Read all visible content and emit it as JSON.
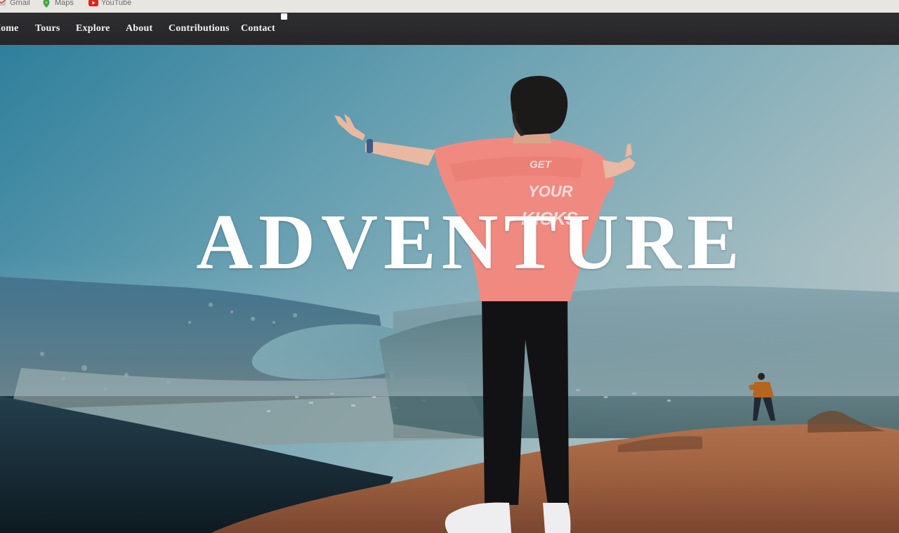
{
  "bookmarks": [
    {
      "label": "Gmail",
      "icon": "gmail-icon"
    },
    {
      "label": "Maps",
      "icon": "maps-pin-icon"
    },
    {
      "label": "YouTube",
      "icon": "youtube-icon"
    }
  ],
  "nav": {
    "home": "Home",
    "tours": "Tours",
    "explore": "Explore",
    "about": "About",
    "contributions": "Contributions",
    "contact": "Contact"
  },
  "hero": {
    "title": "ADVENTURE",
    "shirt_text": [
      "GET",
      "YOUR",
      "KICKS"
    ]
  },
  "colors": {
    "navbar_bg": "#2a2a2c",
    "nav_text": "#f2f2f2",
    "title_text": "#ffffff",
    "shirt": "#f08a80"
  }
}
